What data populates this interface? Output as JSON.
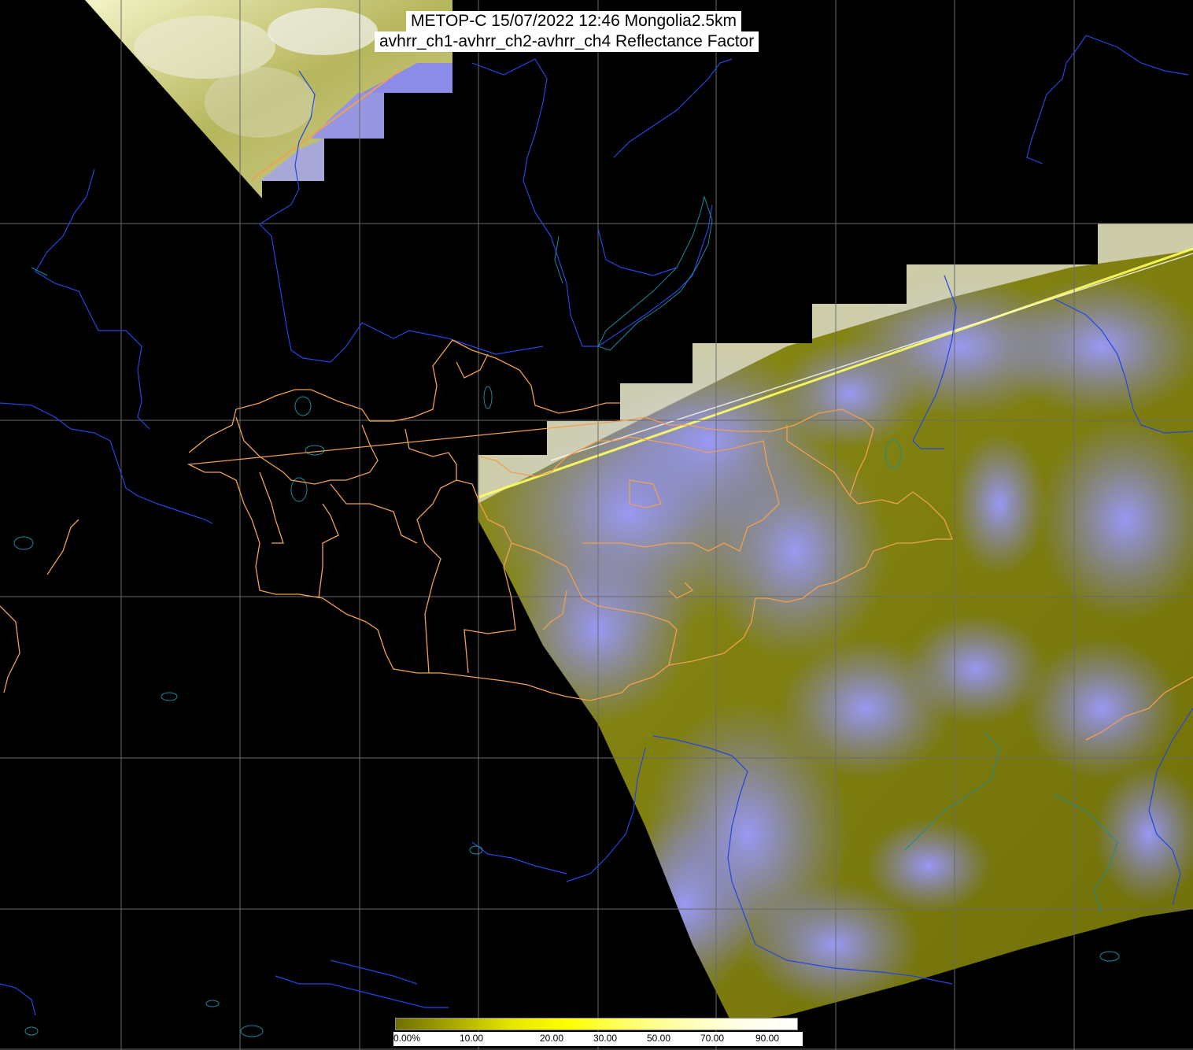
{
  "title": {
    "line1": "METOP-C 15/07/2022 12:46 Mongolia2.5km",
    "line2": "avhrr_ch1-avhrr_ch2-avhrr_ch4 Reflectance Factor"
  },
  "colorbar": {
    "gradient": [
      "#6e6e00",
      "#a8a800",
      "#e6e600",
      "#ffff00",
      "#ffff66",
      "#ffffb0",
      "#ffffe6",
      "#ffffff"
    ],
    "ticks": [
      {
        "label": "0.00%",
        "value": 0
      },
      {
        "label": "10.00",
        "value": 10
      },
      {
        "label": "20.00",
        "value": 20
      },
      {
        "label": "30.00",
        "value": 30
      },
      {
        "label": "50.00",
        "value": 50
      },
      {
        "label": "70.00",
        "value": 70
      },
      {
        "label": "90.00",
        "value": 90
      }
    ]
  },
  "colors": {
    "background": "#000000",
    "grid": "#6a6a6a",
    "coastline": "#1f3dd6",
    "lakes": "#1a7a8a",
    "admin_boundary": "#f0a050",
    "clear_surface": "#8a8a10",
    "cloud": "#8888f0"
  }
}
